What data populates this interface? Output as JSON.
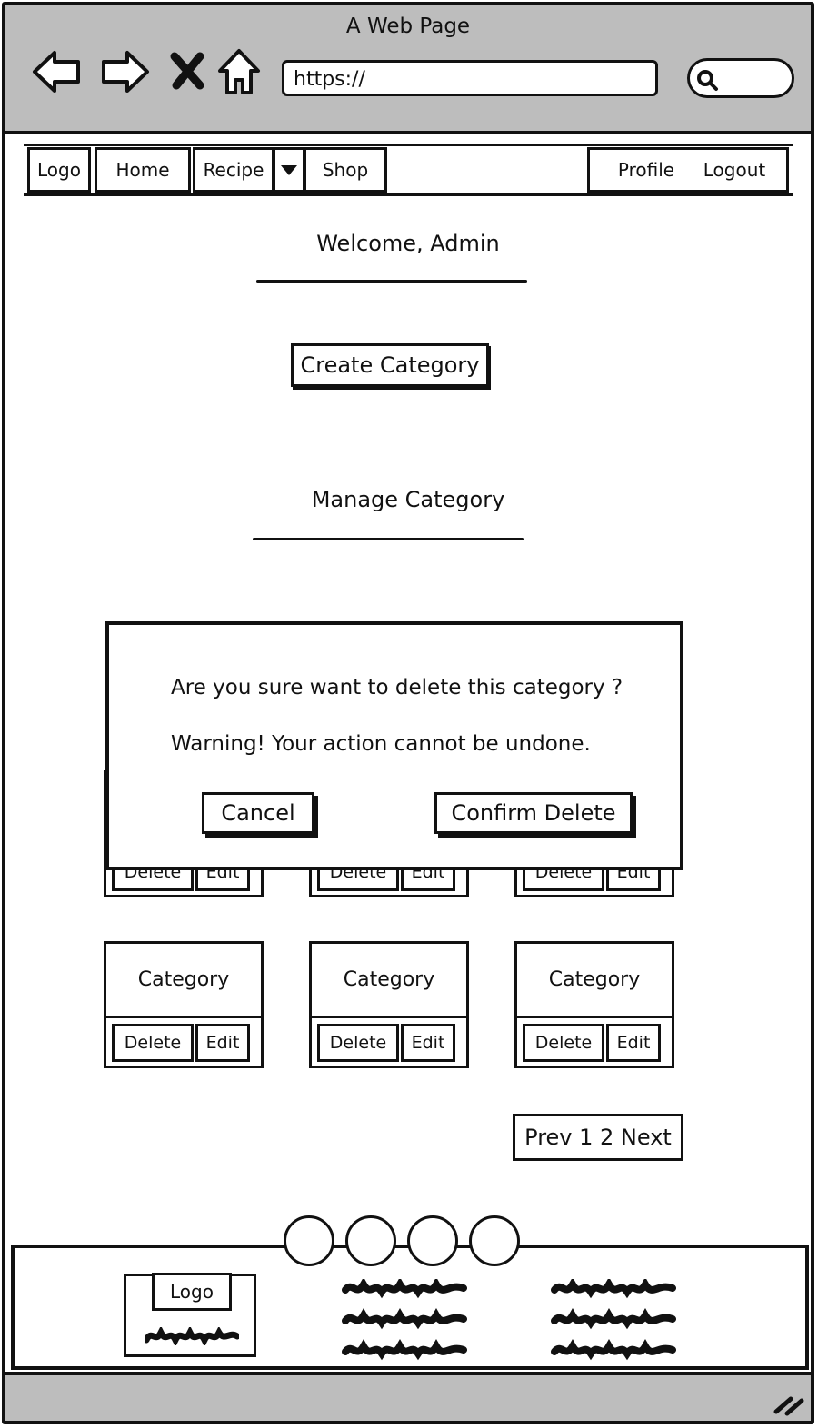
{
  "window": {
    "title": "A Web Page"
  },
  "browser": {
    "url": "https://",
    "icons": [
      "back-arrow-icon",
      "forward-arrow-icon",
      "close-x-icon",
      "home-icon",
      "search-icon"
    ]
  },
  "nav": {
    "logo": "Logo",
    "home": "Home",
    "recipe": "Recipe",
    "shop": "Shop",
    "profile": "Profile",
    "logout": "Logout"
  },
  "welcome": "Welcome, Admin",
  "create_button": "Create Category",
  "manage_heading": "Manage Category",
  "cards_top_row": [
    {
      "delete": "Delete",
      "edit": "Edit"
    },
    {
      "delete": "Delete",
      "edit": "Edit"
    },
    {
      "delete": "Delete",
      "edit": "Edit"
    }
  ],
  "cards": [
    {
      "title": "Category",
      "delete": "Delete",
      "edit": "Edit"
    },
    {
      "title": "Category",
      "delete": "Delete",
      "edit": "Edit"
    },
    {
      "title": "Category",
      "delete": "Delete",
      "edit": "Edit"
    }
  ],
  "pagination": "Prev 1 2 Next",
  "modal": {
    "question": "Are you sure want to delete this category ?",
    "warning": "Warning! Your action cannot be undone.",
    "cancel": "Cancel",
    "confirm": "Confirm Delete"
  },
  "footer": {
    "logo": "Logo"
  }
}
